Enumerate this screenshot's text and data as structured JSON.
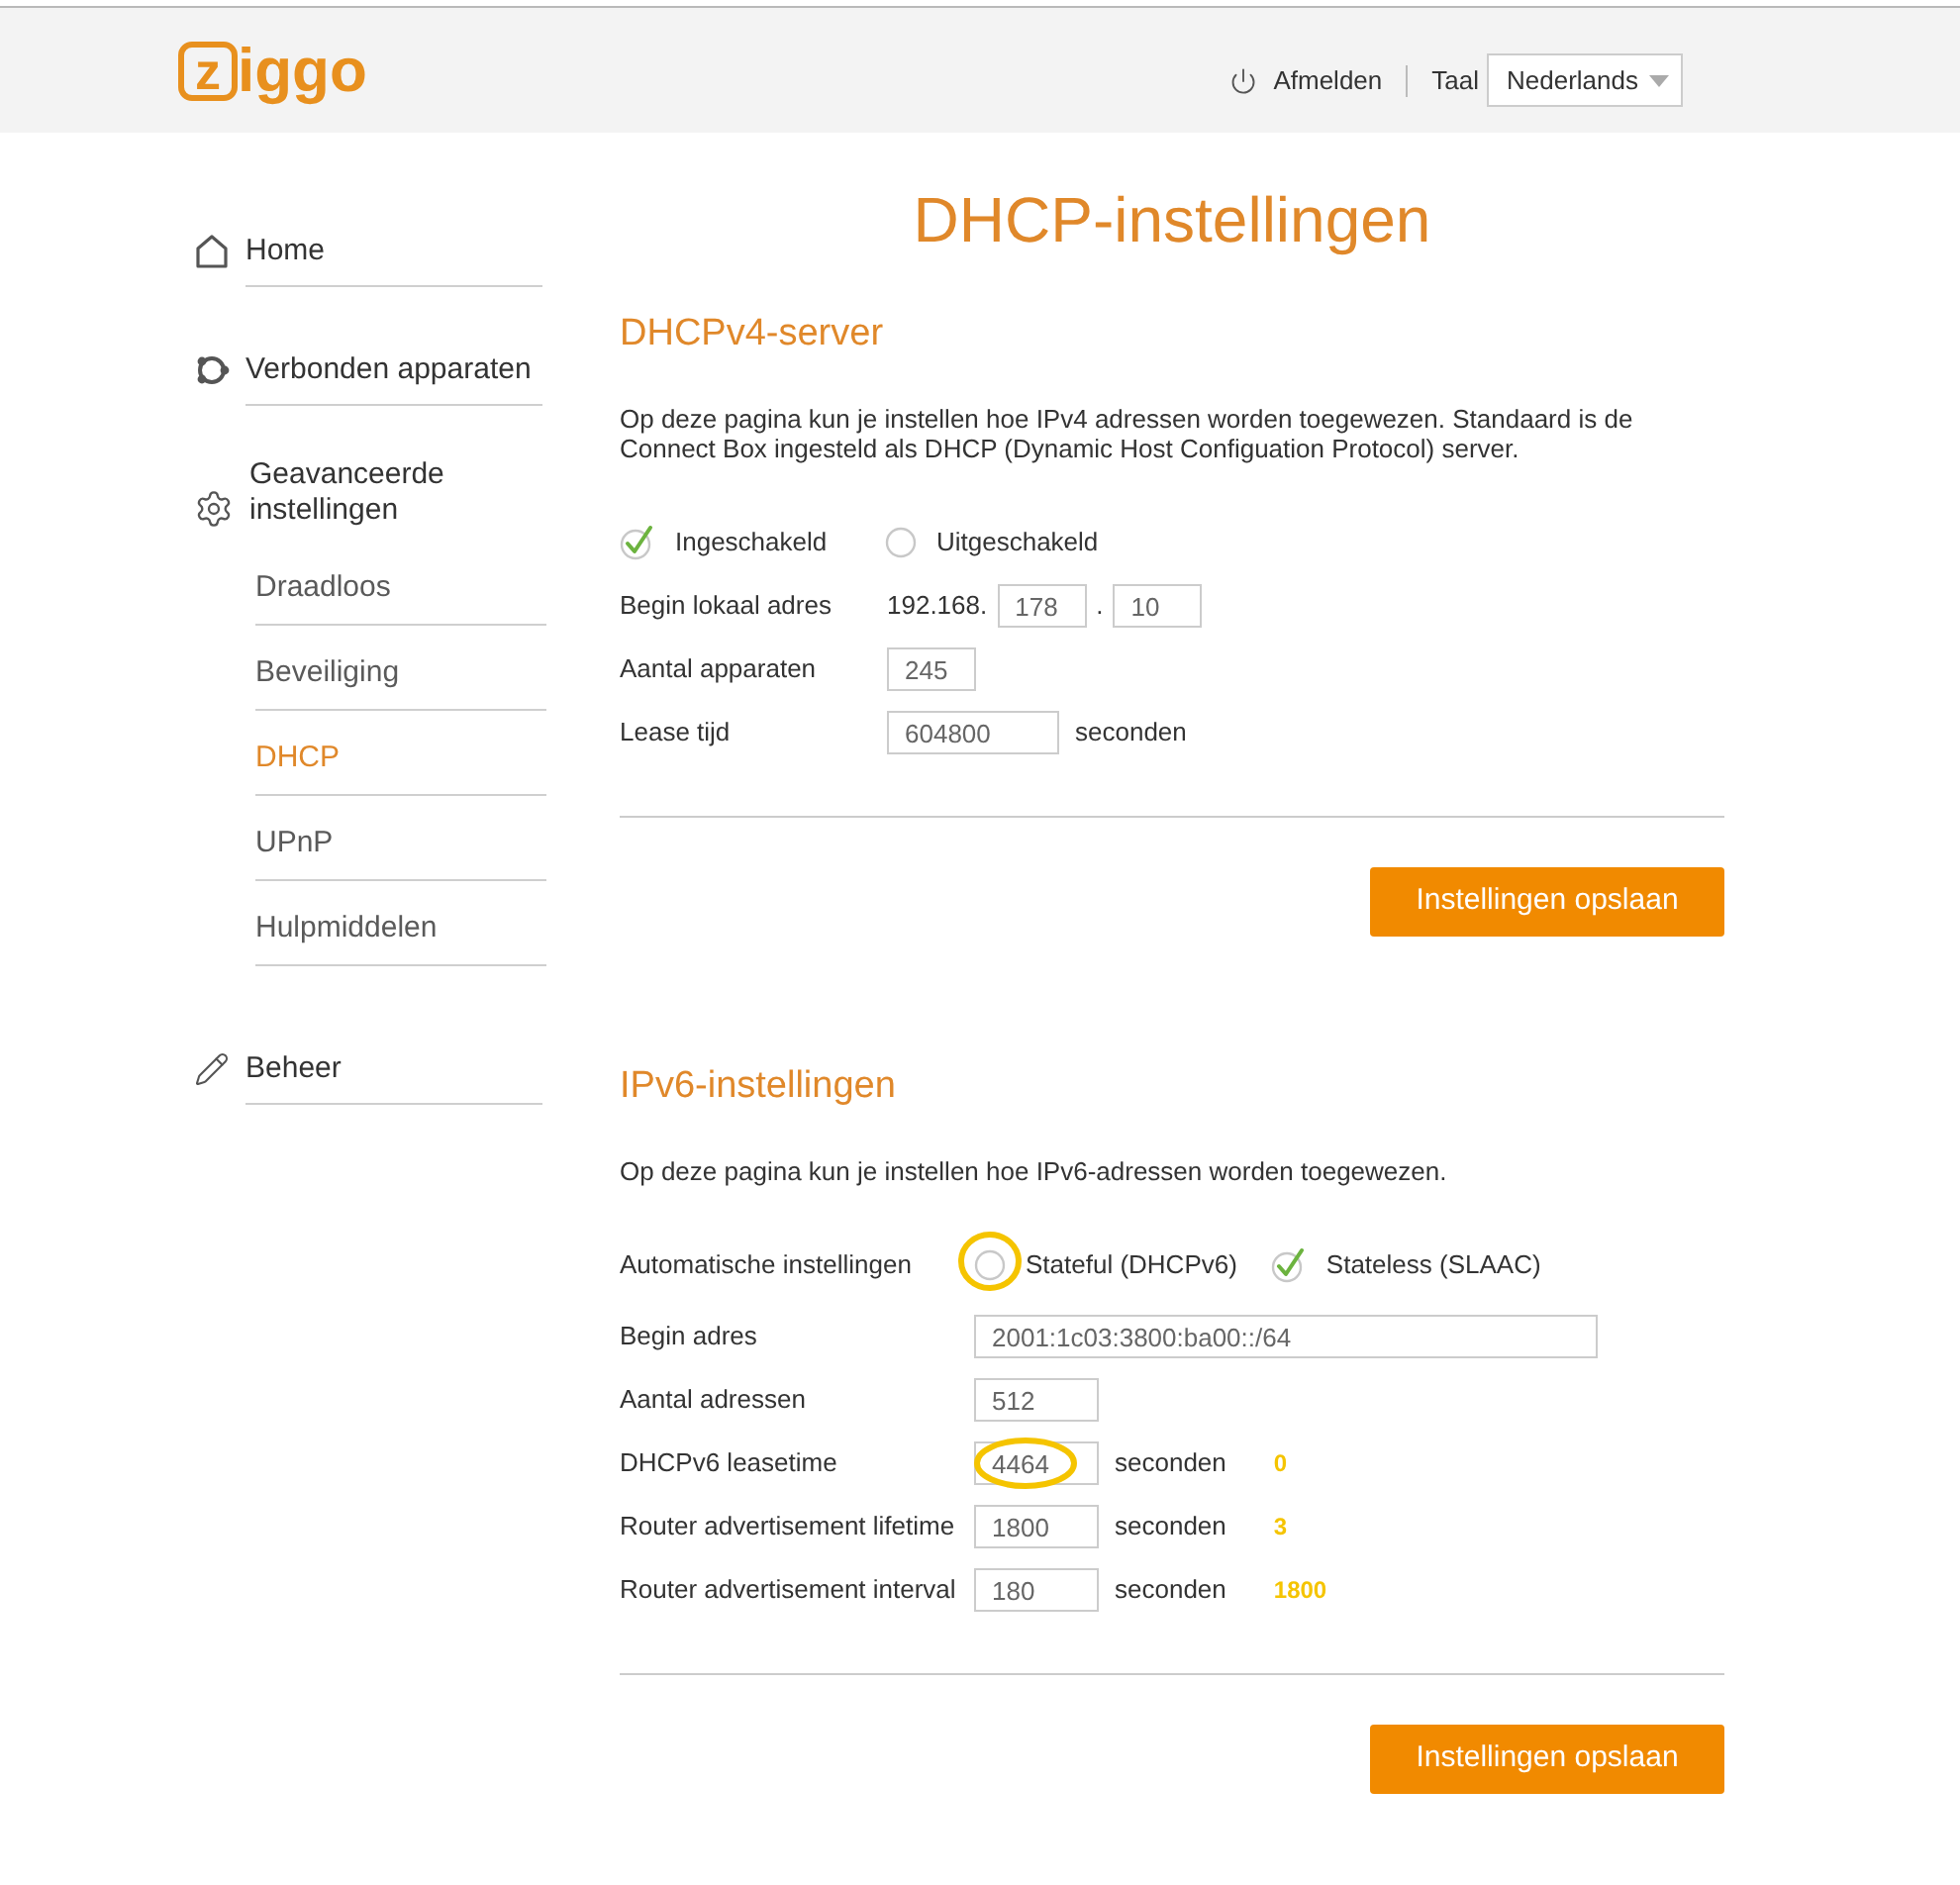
{
  "header": {
    "logo": "ziggo",
    "logout": "Afmelden",
    "language_label": "Taal",
    "language": "Nederlands"
  },
  "sidebar": {
    "items": [
      {
        "label": "Home",
        "selected": false
      },
      {
        "label": "Verbonden apparaten",
        "selected": false
      },
      {
        "label": "Geavanceerde instellingen",
        "selected": false,
        "expanded": true,
        "children": [
          {
            "label": "Draadloos",
            "selected": false
          },
          {
            "label": "Beveiliging",
            "selected": false
          },
          {
            "label": "DHCP",
            "selected": true
          },
          {
            "label": "UPnP",
            "selected": false
          },
          {
            "label": "Hulpmiddelen",
            "selected": false
          }
        ]
      },
      {
        "label": "Beheer",
        "selected": false
      }
    ]
  },
  "page_title": "DHCP-instellingen",
  "sections": [
    {
      "heading": "DHCPv4-server",
      "intro": "Op deze pagina kun je instellen hoe IPv4 adressen worden toegewezen. Standaard is de Connect Box ingesteld als DHCP (Dynamic Host Configuation Protocol) server.",
      "choice": {
        "options": [
          {
            "label": "Ingeschakeld",
            "selected": true,
            "circled": false
          },
          {
            "label": "Uitgeschakeld",
            "selected": false,
            "circled": false
          }
        ]
      },
      "rows": [
        {
          "label": "Begin lokaal adres",
          "parts": [
            {
              "kind": "prefix",
              "text": "192.168."
            },
            {
              "kind": "input",
              "value": "178",
              "circled": false
            },
            {
              "kind": "separator",
              "text": "."
            },
            {
              "kind": "input",
              "value": "10",
              "circled": false
            }
          ]
        },
        {
          "label": "Aantal apparaten",
          "parts": [
            {
              "kind": "input",
              "value": "245",
              "circled": false
            }
          ]
        },
        {
          "label": "Lease tijd",
          "parts": [
            {
              "kind": "input",
              "value": "604800",
              "circled": false
            },
            {
              "kind": "unit",
              "text": "seconden"
            }
          ]
        }
      ],
      "button": "Instellingen opslaan"
    },
    {
      "heading": "IPv6-instellingen",
      "intro": "Op deze pagina kun je instellen hoe IPv6-adressen worden toegewezen.",
      "choice": {
        "label": "Automatische instellingen",
        "options": [
          {
            "label": "Stateful (DHCPv6)",
            "selected": false,
            "circled": true
          },
          {
            "label": "Stateless (SLAAC)",
            "selected": true,
            "circled": false
          }
        ]
      },
      "rows": [
        {
          "label": "Begin adres",
          "parts": [
            {
              "kind": "input",
              "value": "2001:1c03:3800:ba00::/64",
              "circled": false
            }
          ]
        },
        {
          "label": "Aantal adressen",
          "parts": [
            {
              "kind": "input",
              "value": "512",
              "circled": false
            }
          ]
        },
        {
          "label": "DHCPv6 leasetime",
          "parts": [
            {
              "kind": "input",
              "value": "4464",
              "circled": true
            },
            {
              "kind": "unit",
              "text": "seconden"
            },
            {
              "kind": "note",
              "text": "0"
            }
          ]
        },
        {
          "label": "Router advertisement lifetime",
          "parts": [
            {
              "kind": "input",
              "value": "1800",
              "circled": false
            },
            {
              "kind": "unit",
              "text": "seconden"
            },
            {
              "kind": "note",
              "text": "3"
            }
          ]
        },
        {
          "label": "Router advertisement interval",
          "parts": [
            {
              "kind": "input",
              "value": "180",
              "circled": false
            },
            {
              "kind": "unit",
              "text": "seconden"
            },
            {
              "kind": "note",
              "text": "1800"
            }
          ]
        }
      ],
      "button": "Instellingen opslaan"
    }
  ]
}
